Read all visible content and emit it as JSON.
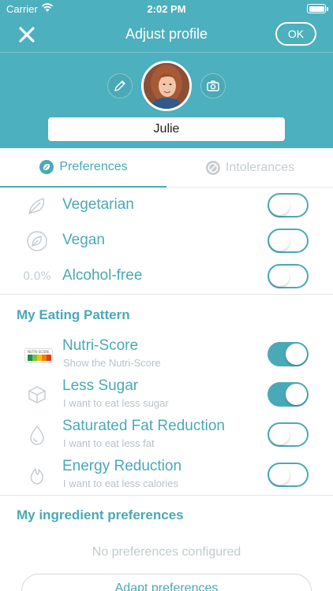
{
  "status_bar": {
    "carrier": "Carrier",
    "time": "2:02 PM"
  },
  "navbar": {
    "title": "Adjust profile",
    "ok_label": "OK"
  },
  "profile": {
    "name": "Julie"
  },
  "tabs": [
    {
      "label": "Preferences",
      "active": true
    },
    {
      "label": "Intolerances",
      "active": false
    }
  ],
  "diet_preferences": [
    {
      "label": "Vegetarian",
      "icon": "leaf-icon",
      "enabled": false
    },
    {
      "label": "Vegan",
      "icon": "vegan-leaf-icon",
      "enabled": false
    },
    {
      "label": "Alcohol-free",
      "icon": "alcohol-free-icon",
      "icon_text": "0.0%",
      "enabled": false
    }
  ],
  "eating_pattern": {
    "title": "My Eating Pattern",
    "items": [
      {
        "label": "Nutri-Score",
        "subtitle": "Show the Nutri-Score",
        "icon": "nutri-score-icon",
        "enabled": true
      },
      {
        "label": "Less Sugar",
        "subtitle": "I want to eat less sugar",
        "icon": "sugar-cube-icon",
        "enabled": true
      },
      {
        "label": "Saturated Fat Reduction",
        "subtitle": "I want to eat less fat",
        "icon": "fat-drop-icon",
        "enabled": false
      },
      {
        "label": "Energy Reduction",
        "subtitle": "I want to eat less calories",
        "icon": "flame-icon",
        "enabled": false
      }
    ]
  },
  "ingredient_preferences": {
    "title": "My ingredient preferences",
    "empty_text": "No preferences configured",
    "button_label": "Adapt preferences"
  },
  "nutri_score_badge": {
    "text": "NUTRI-SCORE",
    "grades": [
      "A",
      "B",
      "C",
      "D",
      "E"
    ]
  },
  "colors": {
    "accent": "#4aa9b7",
    "header": "#4db0be",
    "muted": "#b9c2c7",
    "nutri": [
      "#1e8f4e",
      "#7ac143",
      "#f6c200",
      "#ee8100",
      "#e63e11"
    ]
  }
}
